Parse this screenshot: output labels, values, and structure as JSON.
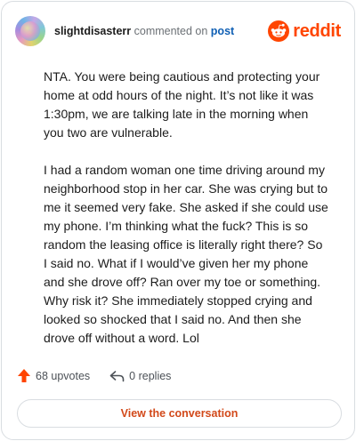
{
  "header": {
    "username": "slightdisasterr",
    "commented_on": "commented on",
    "post_link": "post",
    "logo_text": "reddit"
  },
  "comment": {
    "paragraphs": [
      "NTA. You were being cautious and protecting your home at odd hours of the night. It’s not like it was 1:30pm, we are talking late in the morning when you two are vulnerable.",
      "I had a random woman one time driving around my neighborhood stop in her car. She was crying but to me it seemed very fake. She asked if she could use my phone. I’m thinking what the fuck? This is so random the leasing office is literally right there? So I said no. What if I would’ve given her my phone and she drove off? Ran over my toe or something. Why risk it? She immediately stopped crying and looked so shocked that I said no. And then she drove off without a word. Lol"
    ]
  },
  "stats": {
    "upvotes": "68 upvotes",
    "replies": "0 replies"
  },
  "actions": {
    "view_conversation": "View the conversation"
  },
  "colors": {
    "brand": "#ff4500",
    "link": "#0f5fb4",
    "button_text": "#d2491a"
  },
  "icons": {
    "logo": "reddit-snoo-icon",
    "upvote": "upvote-arrow-icon",
    "reply": "reply-arrow-icon"
  }
}
